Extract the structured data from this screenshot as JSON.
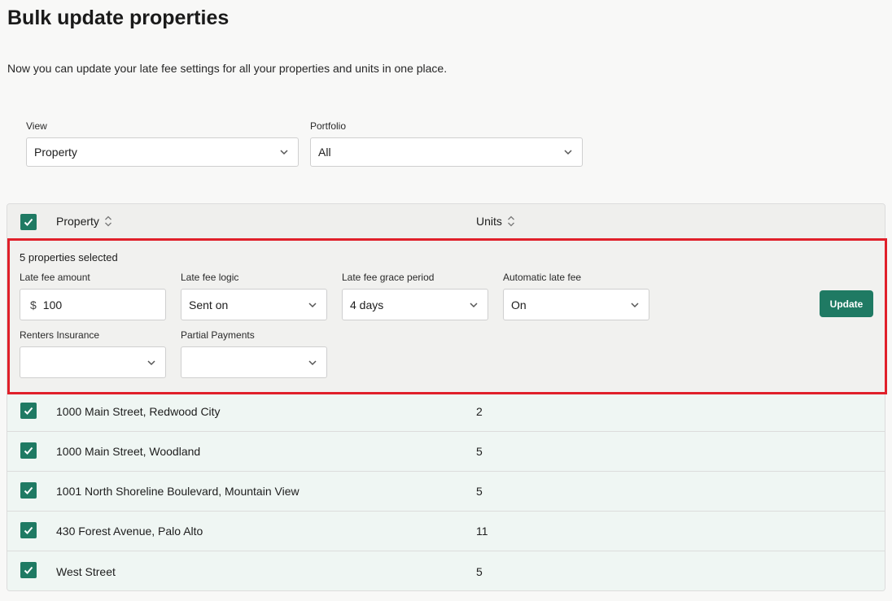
{
  "page": {
    "title": "Bulk update properties",
    "subtitle": "Now you can update your late fee settings for all your properties and units in one place."
  },
  "filters": {
    "view_label": "View",
    "view_value": "Property",
    "portfolio_label": "Portfolio",
    "portfolio_value": "All"
  },
  "table": {
    "columns": [
      "Property",
      "Units"
    ],
    "rows": [
      {
        "property": "1000 Main Street, Redwood City",
        "units": "2",
        "checked": true
      },
      {
        "property": "1000 Main Street, Woodland",
        "units": "5",
        "checked": true
      },
      {
        "property": "1001 North Shoreline Boulevard, Mountain View",
        "units": "5",
        "checked": true
      },
      {
        "property": "430 Forest Avenue, Palo Alto",
        "units": "11",
        "checked": true
      },
      {
        "property": "West Street",
        "units": "5",
        "checked": true
      }
    ]
  },
  "bulk_panel": {
    "selected_text": "5 properties selected",
    "late_fee_amount_label": "Late fee amount",
    "currency_symbol": "$",
    "late_fee_amount_value": "100",
    "late_fee_logic_label": "Late fee logic",
    "late_fee_logic_value": "Sent on",
    "grace_period_label": "Late fee grace period",
    "grace_period_value": "4 days",
    "automatic_late_fee_label": "Automatic late fee",
    "automatic_late_fee_value": "On",
    "renters_insurance_label": "Renters Insurance",
    "renters_insurance_value": "",
    "partial_payments_label": "Partial Payments",
    "partial_payments_value": "",
    "update_button": "Update"
  },
  "colors": {
    "accent": "#1f7a63",
    "highlight_border": "#e0202a",
    "row_background": "#eff6f3"
  }
}
